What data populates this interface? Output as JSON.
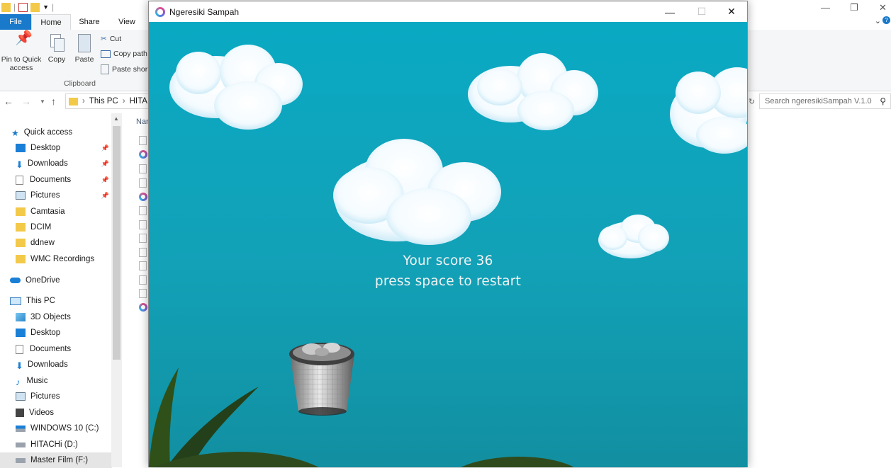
{
  "explorer": {
    "tabs": {
      "file": "File",
      "home": "Home",
      "share": "Share",
      "view": "View"
    },
    "ribbon": {
      "pin": [
        "Pin to Quick",
        "access"
      ],
      "copy": "Copy",
      "paste": "Paste",
      "cut": "Cut",
      "copy_path": "Copy path",
      "paste_shortcut": "Paste shor",
      "group": "Clipboard"
    },
    "address": {
      "this_pc": "This PC",
      "drive": "HITA"
    },
    "search": {
      "placeholder": "Search ngeresikiSampah V.1.0"
    },
    "column_header": "Nar",
    "nav": {
      "quick_access": "Quick access",
      "desktop": "Desktop",
      "downloads": "Downloads",
      "documents": "Documents",
      "pictures": "Pictures",
      "camtasia": "Camtasia",
      "dcim": "DCIM",
      "ddnew": "ddnew",
      "wmc": "WMC Recordings",
      "onedrive": "OneDrive",
      "this_pc": "This PC",
      "objects3d": "3D Objects",
      "desktop2": "Desktop",
      "documents2": "Documents",
      "downloads2": "Downloads",
      "music": "Music",
      "pictures2": "Pictures",
      "videos": "Videos",
      "win10": "WINDOWS 10 (C:)",
      "hitachi": "HITACHi (D:)",
      "master": "Master Film (F:)"
    }
  },
  "game": {
    "title": "Ngeresiki Sampah",
    "score_line": "Your score 36",
    "restart_line": "press space to restart"
  },
  "colors": {
    "sky": "#0aa9c3",
    "file_tab": "#1979ca",
    "cloud": "#ffffff",
    "grass": "#2e4a1c"
  }
}
